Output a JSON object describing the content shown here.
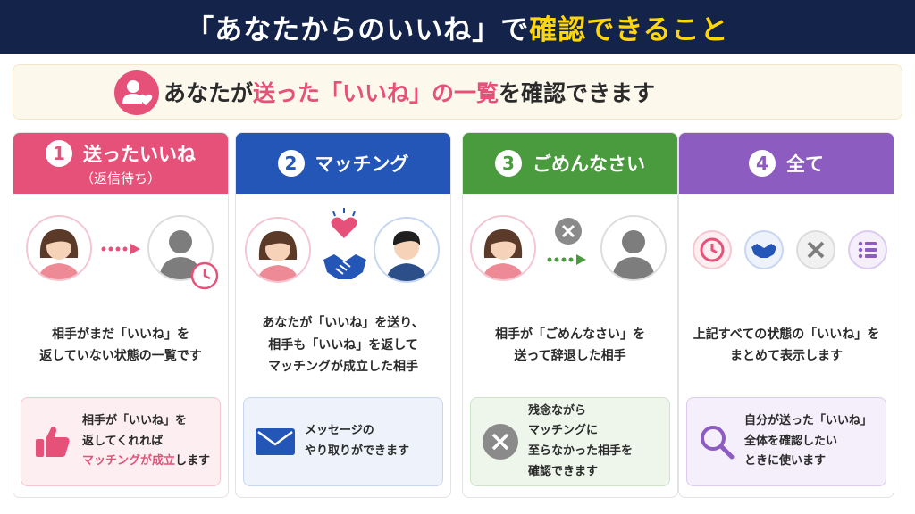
{
  "title": {
    "part1": "「あなたからのいいね」で",
    "part2": "確認できること"
  },
  "subtitle": {
    "part1": "あなたが",
    "part2": "送った「いいね」の一覧",
    "part3": "を確認できます",
    "icon": "user-heart-icon"
  },
  "colors": {
    "pink": "#e6517a",
    "blue": "#2456b8",
    "green": "#4a9a3e",
    "purple": "#8d5cc0",
    "navy": "#14234a",
    "yellow": "#ffd60a"
  },
  "cards": [
    {
      "num": "1",
      "title": "送ったいいね",
      "subtitle": "（返信待ち）",
      "desc": [
        "相手がまだ「いいね」を",
        "返していない状態の一覧です"
      ],
      "note": {
        "lines": [
          "相手が「いいね」を",
          "返してくれれば"
        ],
        "highlight": "マッチングが成立",
        "tail": "します",
        "icon": "thumbs-up-icon"
      }
    },
    {
      "num": "2",
      "title": "マッチング",
      "desc": [
        "あなたが「いいね」を送り、",
        "相手も「いいね」を返して",
        "マッチングが成立した相手"
      ],
      "note": {
        "lines": [
          "メッセージの",
          "やり取りができます"
        ],
        "icon": "mail-icon"
      }
    },
    {
      "num": "3",
      "title": "ごめんなさい",
      "desc": [
        "相手が「ごめんなさい」を",
        "送って辞退した相手"
      ],
      "note": {
        "lines": [
          "残念ながら",
          "マッチングに",
          "至らなかった相手を",
          "確認できます"
        ],
        "icon": "x-circle-icon"
      }
    },
    {
      "num": "4",
      "title": "全て",
      "desc": [
        "上記すべての状態の「いいね」を",
        "まとめて表示します"
      ],
      "note": {
        "lines": [
          "自分が送った「いいね」",
          "全体を確認したい",
          "ときに使います"
        ],
        "icon": "search-icon"
      }
    }
  ]
}
